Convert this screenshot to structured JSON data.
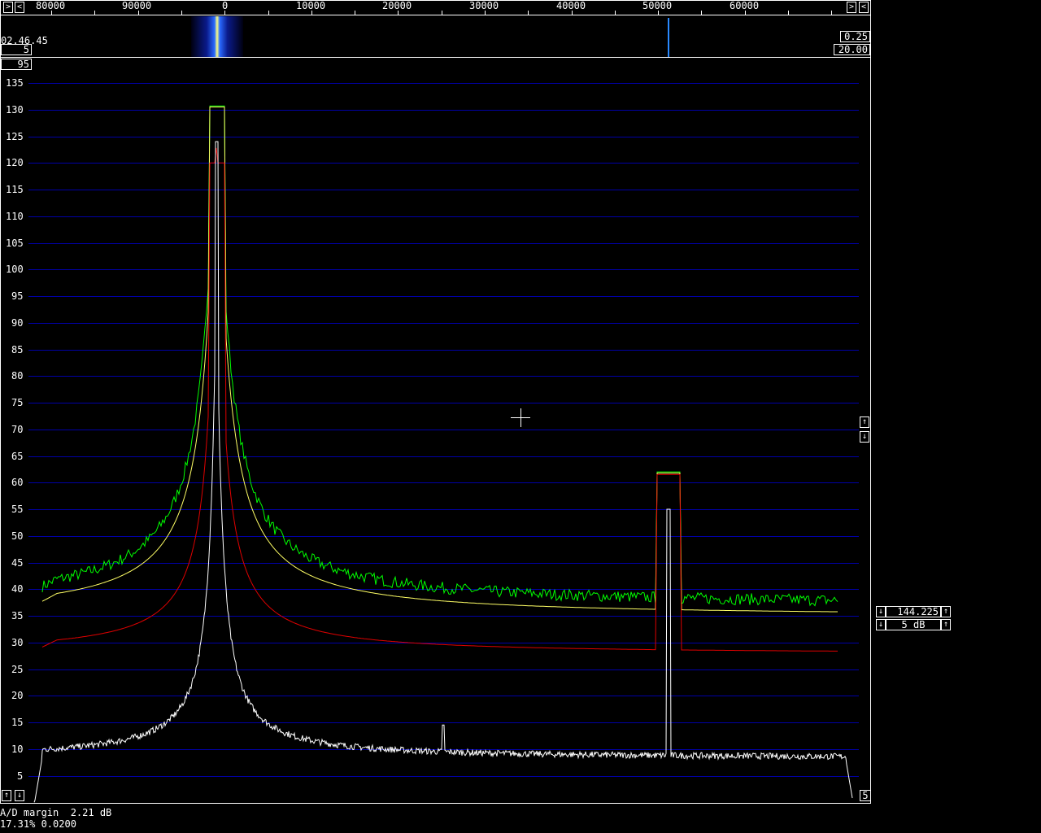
{
  "app": {
    "freq_axis": {
      "scroll_left": "<",
      "scroll_right": ">",
      "ticks": [
        "80000",
        "90000",
        "0",
        "10000",
        "20000",
        "30000",
        "40000",
        "50000",
        "60000"
      ]
    },
    "waterfall": {
      "time": "02.46.45",
      "avg_box": "5",
      "gain_box": "0.25",
      "zero_box": "20.00"
    },
    "spectrum": {
      "top_box": "95",
      "y_ticks": [
        "135",
        "130",
        "125",
        "120",
        "115",
        "110",
        "105",
        "100",
        "95",
        "90",
        "85",
        "80",
        "75",
        "70",
        "65",
        "60",
        "55",
        "50",
        "45",
        "40",
        "35",
        "30",
        "25",
        "20",
        "15",
        "10",
        "5"
      ],
      "bottom_left_btn1": "↑",
      "bottom_left_btn2": "↓",
      "bottom_right_box": "5",
      "right_up_btn": "↑",
      "right_down_btn": "↓"
    },
    "side_panel": {
      "freq_value": "144.225",
      "db_value": "5 dB",
      "down_btn": "↓",
      "up_btn": "↑"
    },
    "status": {
      "line1": "A/D margin  2.21 dB",
      "line2": "17.31% 0.0200"
    },
    "colors": {
      "grid": "#0000a8",
      "trace_green": "#00ff00",
      "trace_yellow": "#ffff66",
      "trace_red": "#e00000",
      "trace_white": "#ffffff"
    }
  }
}
